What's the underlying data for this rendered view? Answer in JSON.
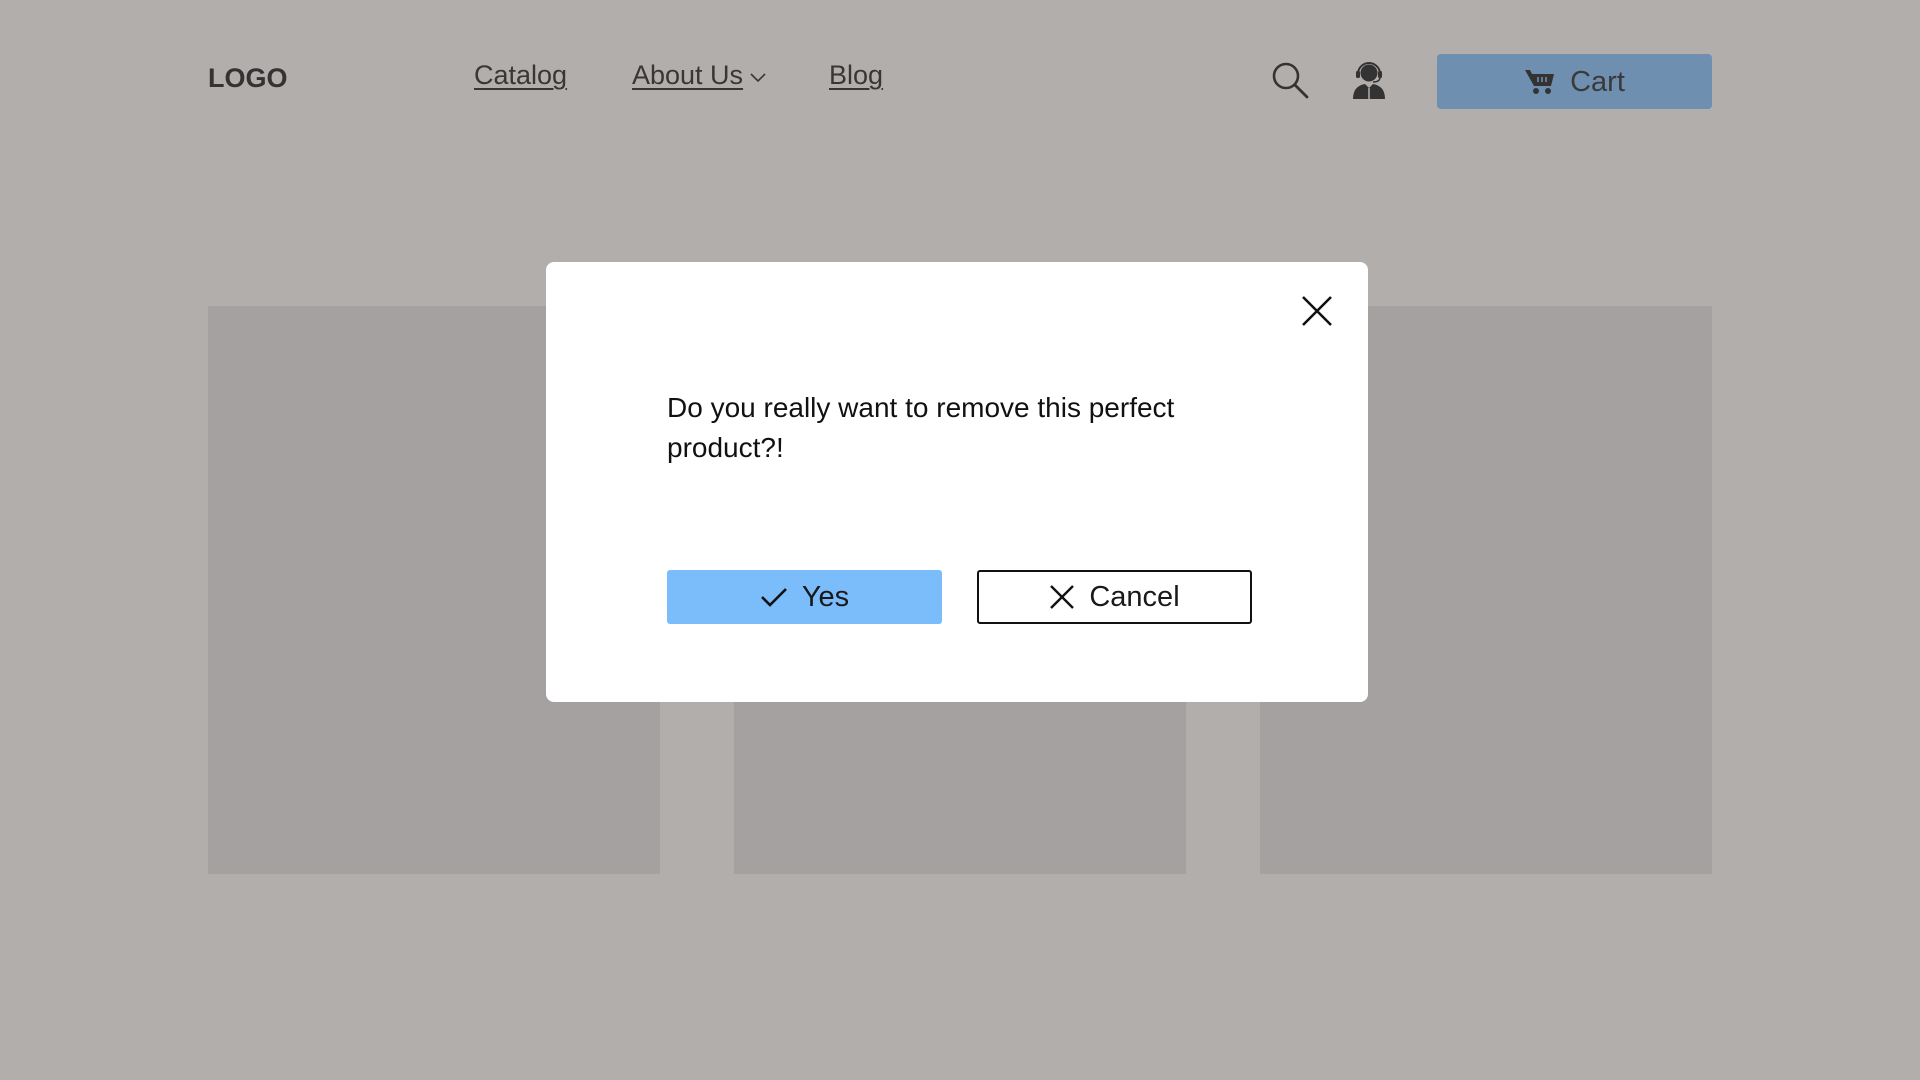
{
  "header": {
    "logo": "LOGO",
    "nav": [
      {
        "label": "Catalog"
      },
      {
        "label": "About Us",
        "has_dropdown": true
      },
      {
        "label": "Blog"
      }
    ],
    "icons": {
      "search": "search-icon",
      "support": "support-agent-icon"
    },
    "cart": {
      "label": "Cart",
      "icon": "cart-icon",
      "color": "#6f8fb0"
    }
  },
  "products": [
    {
      "placeholder": true
    },
    {
      "placeholder": true
    },
    {
      "placeholder": true
    }
  ],
  "modal": {
    "message": "Do you really want to remove this perfect product?!",
    "close_icon": "close-icon",
    "confirm": {
      "label": "Yes",
      "icon": "check-icon",
      "color": "#7bbcfb"
    },
    "cancel": {
      "label": "Cancel",
      "icon": "x-icon"
    }
  },
  "colors": {
    "overlay_background": "#b2aeac",
    "card_placeholder": "#a5a1a0",
    "modal_background": "#ffffff"
  }
}
